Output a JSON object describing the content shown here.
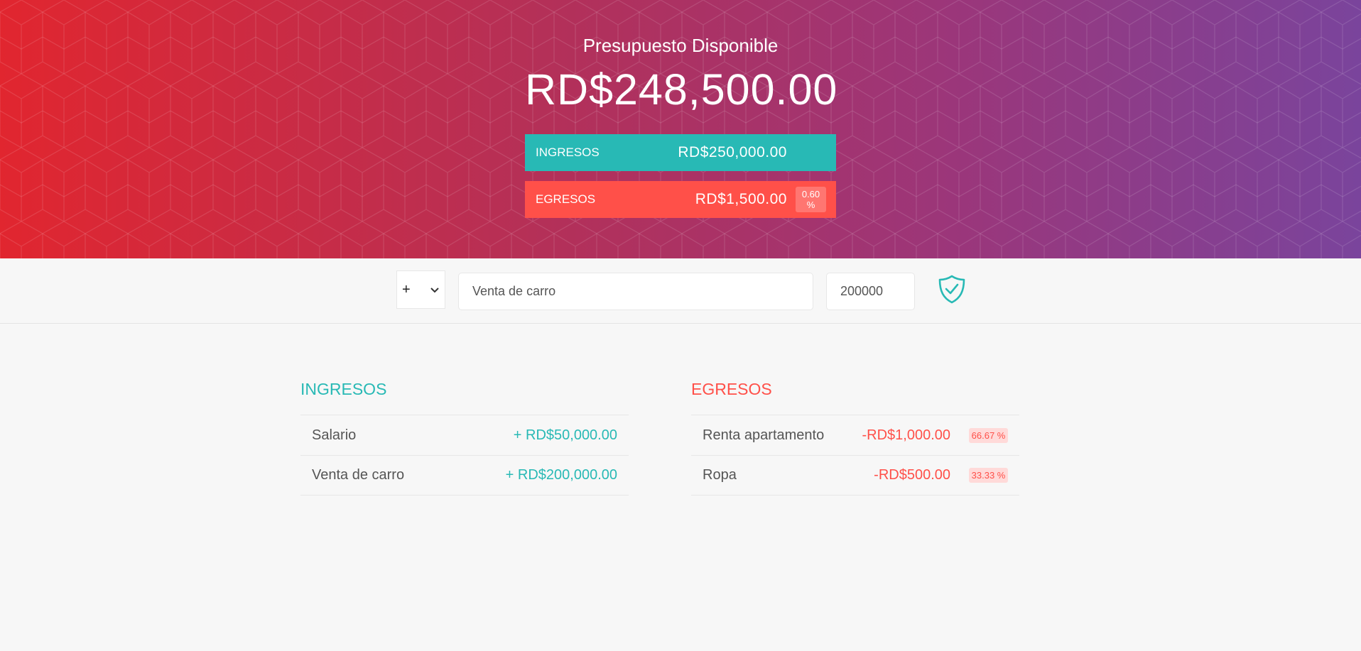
{
  "header": {
    "title": "Presupuesto Disponible",
    "budget": "RD$248,500.00",
    "income": {
      "label": "INGRESOS",
      "value": "RD$250,000.00"
    },
    "expense": {
      "label": "EGRESOS",
      "value": "RD$1,500.00",
      "percentage": "0.60 %"
    }
  },
  "add_form": {
    "type_selected": "+",
    "type_chevron_icon": "chevron-down-icon",
    "description_value": "Venta de carro",
    "amount_value": "200000",
    "submit_icon": "shield-check-icon"
  },
  "income_list": {
    "title": "INGRESOS",
    "items": [
      {
        "description": "Salario",
        "value": "+ RD$50,000.00"
      },
      {
        "description": "Venta de carro",
        "value": "+ RD$200,000.00"
      }
    ]
  },
  "expense_list": {
    "title": "EGRESOS",
    "items": [
      {
        "description": "Renta apartamento",
        "value": "-RD$1,000.00",
        "percentage": "66.67 %"
      },
      {
        "description": "Ropa",
        "value": "-RD$500.00",
        "percentage": "33.33 %"
      }
    ]
  },
  "colors": {
    "income": "#28b9b5",
    "expense": "#ff5049",
    "gradient_start": "#e1262f",
    "gradient_end": "#7a449c"
  }
}
